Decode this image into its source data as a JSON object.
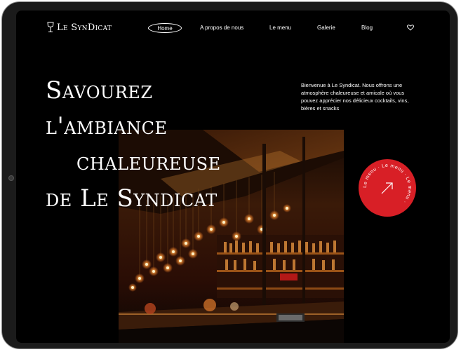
{
  "brand": {
    "name": "Le SynDicat"
  },
  "nav": {
    "home": "Home",
    "about": "A propos de nous",
    "menu": "Le menu",
    "gallery": "Galerie",
    "blog": "Blog"
  },
  "hero": {
    "line1": "Savourez",
    "line2": "l'ambiance",
    "line3": "chaleureuse",
    "line4": "de Le Syndicat",
    "intro": "Bienvenue à Le Syndicat. Nous offrons une atmosphère chaleureuse et amicale où vous pouvez apprécier nos délicieux cocktails, vins, bières et snacks"
  },
  "badge": {
    "text": "Le menu · Le menu · Le menu ·"
  },
  "colors": {
    "accent": "#d81f26",
    "background": "#000000",
    "text": "#ffffff"
  },
  "icons": {
    "logo": "wine-glass-icon",
    "favorite": "heart-icon",
    "badge_arrow": "arrow-up-right-icon"
  }
}
